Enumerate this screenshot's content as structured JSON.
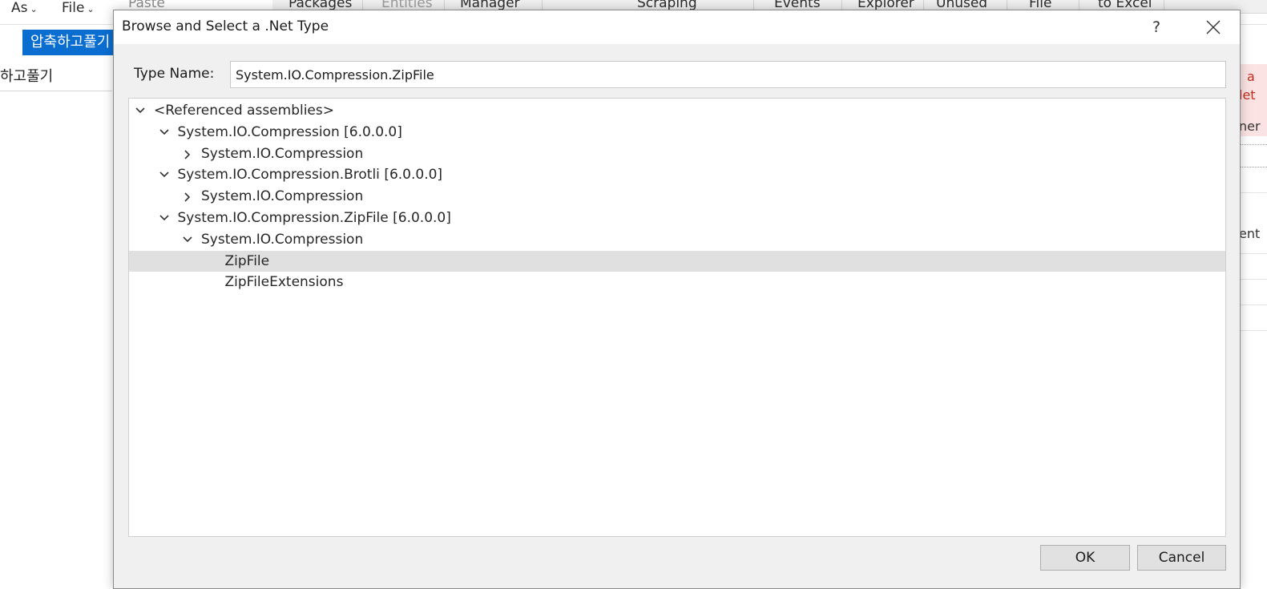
{
  "background": {
    "ribbon_left": [
      {
        "label": "As",
        "chevron": "chevron-down-icon"
      },
      {
        "label": "File",
        "chevron": "chevron-down-icon"
      }
    ],
    "ribbon_right": [
      "Paste",
      "Packages",
      "Entities",
      "Manager",
      "Scraping",
      "Events",
      "Explorer",
      "Unused",
      "File",
      "to Excel"
    ],
    "doc_tab": "압축하고풀기",
    "doc_line": "하고풀기",
    "right_fragments": [
      "a",
      "let",
      "ner",
      "ent"
    ]
  },
  "dialog": {
    "title": "Browse and Select a .Net Type",
    "help_label": "?",
    "close_label": "✕",
    "type_name_label": "Type Name:",
    "type_name_value": "System.IO.Compression.ZipFile",
    "tree": [
      {
        "label": "<Referenced assemblies>",
        "level": 0,
        "state": "expanded"
      },
      {
        "label": "System.IO.Compression [6.0.0.0]",
        "level": 1,
        "state": "expanded"
      },
      {
        "label": "System.IO.Compression",
        "level": 2,
        "state": "collapsed"
      },
      {
        "label": "System.IO.Compression.Brotli [6.0.0.0]",
        "level": 1,
        "state": "expanded"
      },
      {
        "label": "System.IO.Compression",
        "level": 2,
        "state": "collapsed"
      },
      {
        "label": "System.IO.Compression.ZipFile [6.0.0.0]",
        "level": 1,
        "state": "expanded"
      },
      {
        "label": "System.IO.Compression",
        "level": 2,
        "state": "expanded"
      },
      {
        "label": "ZipFile",
        "level": 3,
        "state": "leaf",
        "selected": true
      },
      {
        "label": "ZipFileExtensions",
        "level": 3,
        "state": "leaf"
      }
    ],
    "ok_label": "OK",
    "cancel_label": "Cancel"
  },
  "colors": {
    "accent": "#0a6ed1",
    "selection": "#e0e0e0",
    "dialog_bg": "#f0f0f0"
  }
}
